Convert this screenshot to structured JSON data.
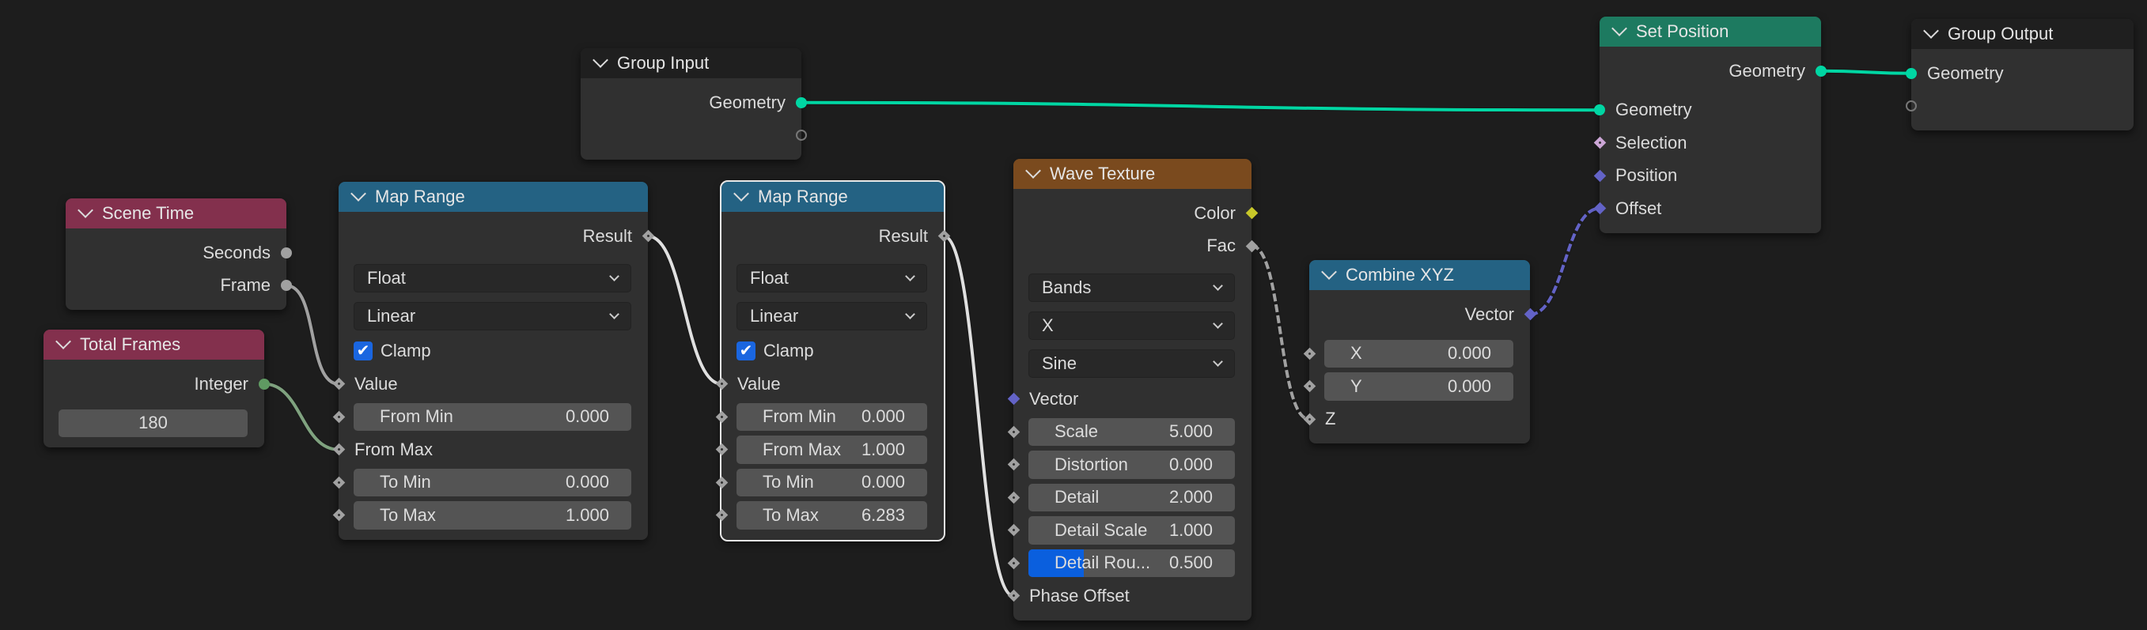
{
  "colors": {
    "geometry": "#00d6a3",
    "float": "#a1a1a1",
    "vector": "#6363c7",
    "color": "#c7c729",
    "integer": "#5f9a62",
    "boolean": "#cca6d6",
    "empty": "#777777"
  },
  "nodes": [
    {
      "id": "group_input",
      "title": "Group Input",
      "header_color": "#1f1f1f",
      "rows": [
        {
          "kind": "out",
          "label": "Geometry",
          "socket": "geometry",
          "shape": "circle"
        },
        {
          "kind": "out",
          "label": "",
          "socket": "empty",
          "shape": "hollow"
        }
      ]
    },
    {
      "id": "set_position",
      "title": "Set Position",
      "header_color": "#1d7a60",
      "rows": [
        {
          "kind": "out",
          "label": "Geometry",
          "socket": "geometry",
          "shape": "circle"
        },
        {
          "kind": "sp"
        },
        {
          "kind": "in",
          "label": "Geometry",
          "socket": "geometry",
          "shape": "circle"
        },
        {
          "kind": "in",
          "label": "Selection",
          "socket": "boolean",
          "shape": "diamond-dot"
        },
        {
          "kind": "in",
          "label": "Position",
          "socket": "vector",
          "shape": "diamond"
        },
        {
          "kind": "in",
          "label": "Offset",
          "socket": "vector",
          "shape": "diamond"
        }
      ]
    },
    {
      "id": "group_output",
      "title": "Group Output",
      "header_color": "#1f1f1f",
      "rows": [
        {
          "kind": "in",
          "label": "Geometry",
          "socket": "geometry",
          "shape": "circle"
        },
        {
          "kind": "in",
          "label": "",
          "socket": "empty",
          "shape": "hollow"
        }
      ]
    },
    {
      "id": "scene_time",
      "title": "Scene Time",
      "header_color": "#83304d",
      "rows": [
        {
          "kind": "out",
          "label": "Seconds",
          "socket": "float",
          "shape": "circle"
        },
        {
          "kind": "out",
          "label": "Frame",
          "socket": "float",
          "shape": "circle"
        }
      ]
    },
    {
      "id": "total_frames",
      "title": "Total Frames",
      "header_color": "#83304d",
      "rows": [
        {
          "kind": "out",
          "label": "Integer",
          "socket": "integer",
          "shape": "circle"
        },
        {
          "kind": "sp"
        },
        {
          "kind": "intfield",
          "value": "180"
        }
      ]
    },
    {
      "id": "map_range_1",
      "title": "Map Range",
      "header_color": "#246283",
      "rows": [
        {
          "kind": "out",
          "label": "Result",
          "socket": "float",
          "shape": "diamond-dot"
        },
        {
          "kind": "sp"
        },
        {
          "kind": "dropdown",
          "label": "Float"
        },
        {
          "kind": "dropdown",
          "label": "Linear"
        },
        {
          "kind": "checkbox",
          "label": "Clamp",
          "checked": true
        },
        {
          "kind": "in",
          "label": "Value",
          "socket": "float",
          "shape": "diamond-dot"
        },
        {
          "kind": "field",
          "label": "From Min",
          "value": "0.000",
          "socket": "float"
        },
        {
          "kind": "in",
          "label": "From Max",
          "socket": "float",
          "shape": "diamond-dot"
        },
        {
          "kind": "field",
          "label": "To Min",
          "value": "0.000",
          "socket": "float"
        },
        {
          "kind": "field",
          "label": "To Max",
          "value": "1.000",
          "socket": "float"
        }
      ]
    },
    {
      "id": "map_range_2",
      "title": "Map Range",
      "header_color": "#246283",
      "selected": true,
      "rows": [
        {
          "kind": "out",
          "label": "Result",
          "socket": "float",
          "shape": "diamond-dot"
        },
        {
          "kind": "sp"
        },
        {
          "kind": "dropdown",
          "label": "Float"
        },
        {
          "kind": "dropdown",
          "label": "Linear"
        },
        {
          "kind": "checkbox",
          "label": "Clamp",
          "checked": true
        },
        {
          "kind": "in",
          "label": "Value",
          "socket": "float",
          "shape": "diamond-dot"
        },
        {
          "kind": "field",
          "label": "From Min",
          "value": "0.000",
          "socket": "float"
        },
        {
          "kind": "field",
          "label": "From Max",
          "value": "1.000",
          "socket": "float"
        },
        {
          "kind": "field",
          "label": "To Min",
          "value": "0.000",
          "socket": "float"
        },
        {
          "kind": "field",
          "label": "To Max",
          "value": "6.283",
          "socket": "float"
        }
      ]
    },
    {
      "id": "wave_texture",
      "title": "Wave Texture",
      "header_color": "#7a4a1e",
      "rows": [
        {
          "kind": "out",
          "label": "Color",
          "socket": "color",
          "shape": "diamond"
        },
        {
          "kind": "out",
          "label": "Fac",
          "socket": "float",
          "shape": "diamond"
        },
        {
          "kind": "sp"
        },
        {
          "kind": "dropdown",
          "label": "Bands"
        },
        {
          "kind": "dropdown",
          "label": "X"
        },
        {
          "kind": "dropdown",
          "label": "Sine"
        },
        {
          "kind": "in",
          "label": "Vector",
          "socket": "vector",
          "shape": "diamond"
        },
        {
          "kind": "field",
          "label": "Scale",
          "value": "5.000",
          "socket": "float"
        },
        {
          "kind": "field",
          "label": "Distortion",
          "value": "0.000",
          "socket": "float"
        },
        {
          "kind": "field",
          "label": "Detail",
          "value": "2.000",
          "socket": "float"
        },
        {
          "kind": "field",
          "label": "Detail Scale",
          "value": "1.000",
          "socket": "float"
        },
        {
          "kind": "field",
          "label": "Detail Rou...",
          "value": "0.500",
          "socket": "float",
          "fill": 0.5
        },
        {
          "kind": "in",
          "label": "Phase Offset",
          "socket": "float",
          "shape": "diamond-dot"
        }
      ]
    },
    {
      "id": "combine_xyz",
      "title": "Combine XYZ",
      "header_color": "#246283",
      "rows": [
        {
          "kind": "out",
          "label": "Vector",
          "socket": "vector",
          "shape": "diamond"
        },
        {
          "kind": "sp"
        },
        {
          "kind": "field",
          "label": "X",
          "value": "0.000",
          "socket": "float"
        },
        {
          "kind": "field",
          "label": "Y",
          "value": "0.000",
          "socket": "float"
        },
        {
          "kind": "in",
          "label": "Z",
          "socket": "float",
          "shape": "diamond-dot"
        }
      ]
    }
  ],
  "links": [
    {
      "from": "group_input.0",
      "to": "set_position.2",
      "color": "#00d6a3"
    },
    {
      "from": "set_position.0",
      "to": "group_output.0",
      "color": "#00d6a3"
    },
    {
      "from": "scene_time.1",
      "to": "map_range_1.5",
      "color": "#a1a1a1"
    },
    {
      "from": "total_frames.0",
      "to": "map_range_1.7",
      "color": "#7fa27f"
    },
    {
      "from": "map_range_1.0",
      "to": "map_range_2.5",
      "color": "#e0e0e0"
    },
    {
      "from": "map_range_2.0",
      "to": "wave_texture.12",
      "color": "#e0e0e0"
    },
    {
      "from": "wave_texture.1",
      "to": "combine_xyz.4",
      "color": "#a1a1a1",
      "dashed": true
    },
    {
      "from": "combine_xyz.0",
      "to": "set_position.5",
      "color": "#6363c7",
      "dashed": true
    }
  ]
}
